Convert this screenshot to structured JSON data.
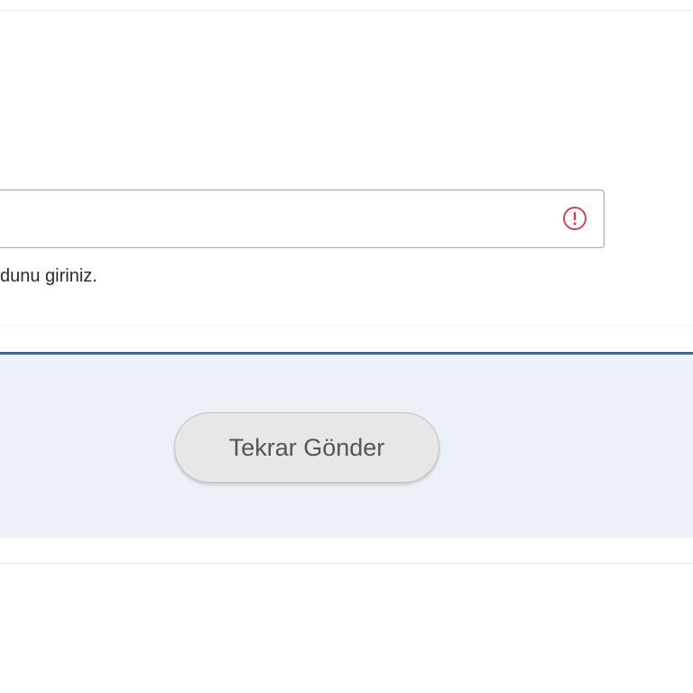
{
  "form": {
    "code_input": {
      "value": "",
      "placeholder": ""
    },
    "error_icon": "exclamation-circle-icon",
    "helper_text": "dunu giriniz."
  },
  "actions": {
    "resend_label": "Tekrar Gönder"
  },
  "colors": {
    "error": "#e0323c",
    "panel_background": "#ecf1f7",
    "panel_border": "#2f6e9e",
    "button_background": "#e7e7e7",
    "button_text": "#555555"
  }
}
